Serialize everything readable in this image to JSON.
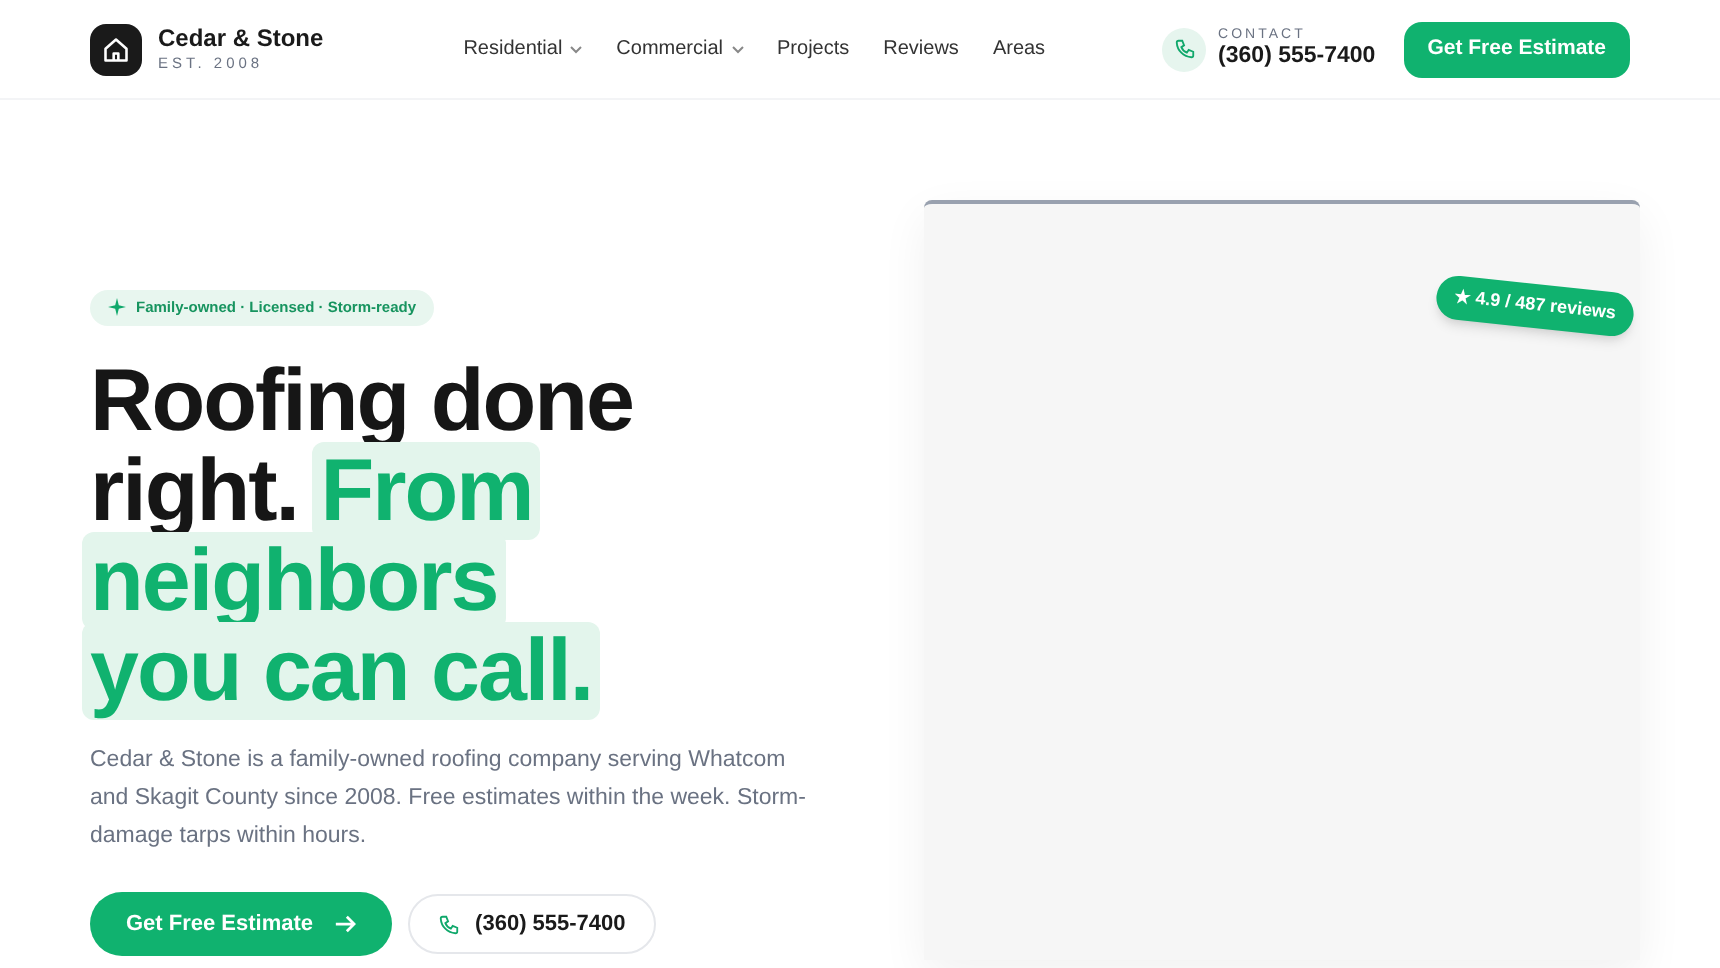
{
  "brand": {
    "name": "Cedar & Stone",
    "tagline": "EST. 2008"
  },
  "nav": [
    {
      "label": "Residential",
      "has_menu": true
    },
    {
      "label": "Commercial",
      "has_menu": true
    },
    {
      "label": "Projects",
      "has_menu": false
    },
    {
      "label": "Reviews",
      "has_menu": false
    },
    {
      "label": "Areas",
      "has_menu": false
    }
  ],
  "contact": {
    "label": "CONTACT",
    "phone": "(360) 555-7400"
  },
  "header_cta": "Get Free Estimate",
  "hero": {
    "badge": "Family-owned · Licensed · Storm-ready",
    "headline_lead": "Roofing done right.",
    "headline_accent_lines": [
      "From",
      "neighbors",
      "you can call."
    ],
    "description": "Cedar & Stone is a family-owned roofing company serving Whatcom and Skagit County since 2008. Free estimates within the week. Storm-damage tarps within hours.",
    "primary_button": "Get Free Estimate",
    "phone_button": "(360) 555-7400"
  },
  "rating_badge": "★ 4.9 / 487 reviews"
}
